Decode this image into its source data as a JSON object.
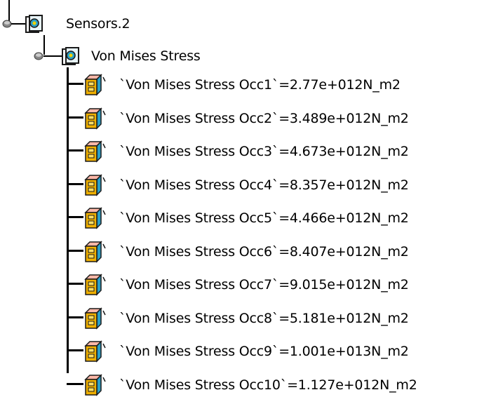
{
  "tree": {
    "root": {
      "label": "Sensors.2",
      "icon": "sensor-icon"
    },
    "child": {
      "label": "Von Mises Stress",
      "icon": "sensor-icon"
    },
    "parameters": [
      {
        "label": "`Von Mises Stress  Occ1`=2.77e+012N_m2",
        "icon": "parameter-icon"
      },
      {
        "label": "`Von Mises Stress  Occ2`=3.489e+012N_m2",
        "icon": "parameter-icon"
      },
      {
        "label": "`Von Mises Stress  Occ3`=4.673e+012N_m2",
        "icon": "parameter-icon"
      },
      {
        "label": "`Von Mises Stress  Occ4`=8.357e+012N_m2",
        "icon": "parameter-icon"
      },
      {
        "label": "`Von Mises Stress  Occ5`=4.466e+012N_m2",
        "icon": "parameter-icon"
      },
      {
        "label": "`Von Mises Stress  Occ6`=8.407e+012N_m2",
        "icon": "parameter-icon"
      },
      {
        "label": "`Von Mises Stress  Occ7`=9.015e+012N_m2",
        "icon": "parameter-icon"
      },
      {
        "label": "`Von Mises Stress  Occ8`=5.181e+012N_m2",
        "icon": "parameter-icon"
      },
      {
        "label": "`Von Mises Stress  Occ9`=1.001e+013N_m2",
        "icon": "parameter-icon"
      },
      {
        "label": "`Von Mises Stress  Occ10`=1.127e+012N_m2",
        "icon": "parameter-icon"
      }
    ]
  },
  "colors": {
    "line": "#000000",
    "param_icon_fill": "#f0b000",
    "param_icon_side": "#ff9c88",
    "sensor_icon_frame": "#1a1a1a",
    "sensor_icon_accent": "#2aa0c8"
  }
}
